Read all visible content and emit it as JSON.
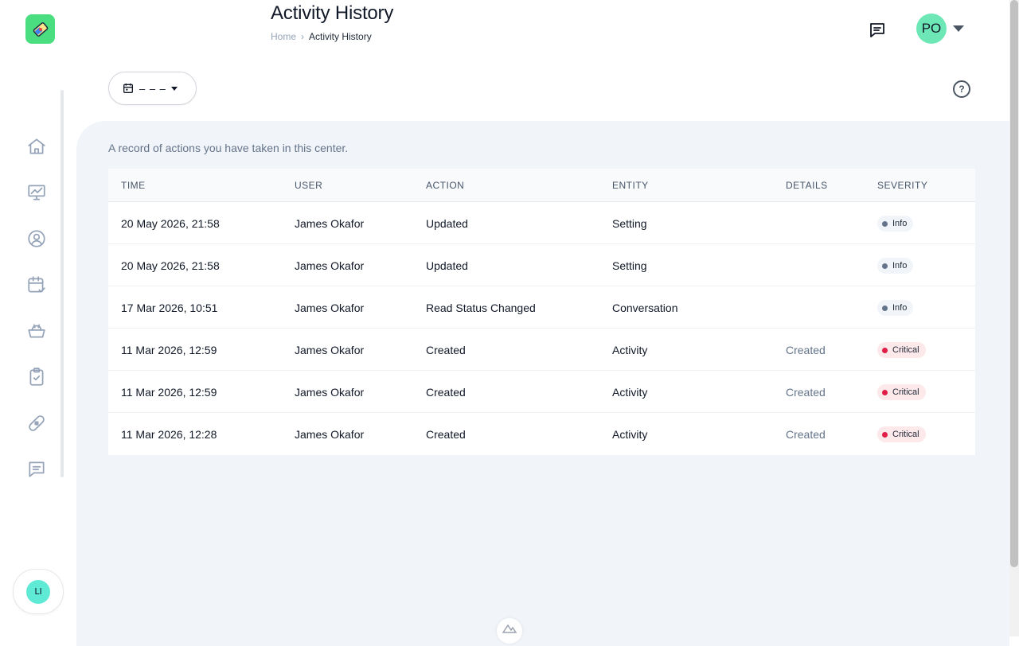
{
  "header": {
    "title": "Activity History",
    "breadcrumb": {
      "home": "Home",
      "current": "Activity History"
    },
    "profile_initials": "PO"
  },
  "sidebar": {
    "items": [
      {
        "icon": "home-icon"
      },
      {
        "icon": "presentation-chart-icon"
      },
      {
        "icon": "user-circle-icon"
      },
      {
        "icon": "calendar-check-icon"
      },
      {
        "icon": "food-bowl-icon"
      },
      {
        "icon": "clipboard-check-icon"
      },
      {
        "icon": "bandage-icon"
      },
      {
        "icon": "message-icon"
      }
    ],
    "user_initials": "LI"
  },
  "filter": {
    "date_value": "– – –"
  },
  "panel": {
    "description": "A record of actions you have taken in this center.",
    "columns": [
      "TIME",
      "USER",
      "ACTION",
      "ENTITY",
      "DETAILS",
      "SEVERITY"
    ],
    "rows": [
      {
        "time": "20 May 2026, 21:58",
        "user": "James Okafor",
        "action": "Updated",
        "entity": "Setting",
        "details": "",
        "severity": "Info"
      },
      {
        "time": "20 May 2026, 21:58",
        "user": "James Okafor",
        "action": "Updated",
        "entity": "Setting",
        "details": "",
        "severity": "Info"
      },
      {
        "time": "17 Mar 2026, 10:51",
        "user": "James Okafor",
        "action": "Read Status Changed",
        "entity": "Conversation",
        "details": "",
        "severity": "Info"
      },
      {
        "time": "11 Mar 2026, 12:59",
        "user": "James Okafor",
        "action": "Created",
        "entity": "Activity",
        "details": "Created",
        "severity": "Critical"
      },
      {
        "time": "11 Mar 2026, 12:59",
        "user": "James Okafor",
        "action": "Created",
        "entity": "Activity",
        "details": "Created",
        "severity": "Critical"
      },
      {
        "time": "11 Mar 2026, 12:28",
        "user": "James Okafor",
        "action": "Created",
        "entity": "Activity",
        "details": "Created",
        "severity": "Critical"
      }
    ]
  },
  "colors": {
    "accent": "#4ade80",
    "panel_bg": "#f1f4f9",
    "critical": "#e11d48",
    "info": "#64748b"
  }
}
